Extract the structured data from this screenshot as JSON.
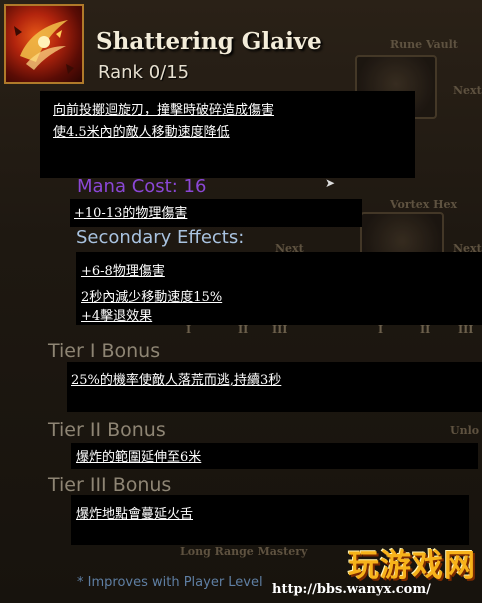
{
  "skill": {
    "name": "Shattering Glaive",
    "rank": "Rank 0/15",
    "description_line1": "向前投擲迴旋刃，撞擊時破碎造成傷害",
    "description_line2": "使4.5米內的敵人移動速度降低",
    "mana_cost": "Mana Cost: 16",
    "primary_effect": "+10-13的物理傷害",
    "secondary_heading": "Secondary Effects:",
    "secondary_effects": [
      "+6-8物理傷害",
      "2秒內減少移動速度15%",
      "+4擊退效果"
    ],
    "tier1_heading": "Tier I Bonus",
    "tier1_text": "25%的機率使敵人落荒而逃,持續3秒",
    "tier2_heading": "Tier II Bonus",
    "tier2_text": "爆炸的範圍延伸至6米",
    "tier3_heading": "Tier III Bonus",
    "tier3_text": "爆炸地點會蔓延火舌",
    "footnote": "* Improves with Player Level"
  },
  "background": {
    "rune_vault": "Rune Vault",
    "vortex_hex": "Vortex Hex",
    "long_range_mastery": "Long Range Mastery",
    "next_label": "Next",
    "unlock_label": "Unlo",
    "roman_numerals": [
      "I",
      "II",
      "III",
      "I",
      "II",
      "III"
    ]
  },
  "watermark": {
    "logo": "玩游戏网",
    "url": "http://bbs.wanyx.com/"
  },
  "colors": {
    "mana": "#8b47d6",
    "secondary": "#a9c3e0",
    "tier": "#8e8574",
    "icon_border": "#b07a2a"
  },
  "icons": {
    "skill_icon": "shattering-glaive-icon"
  }
}
